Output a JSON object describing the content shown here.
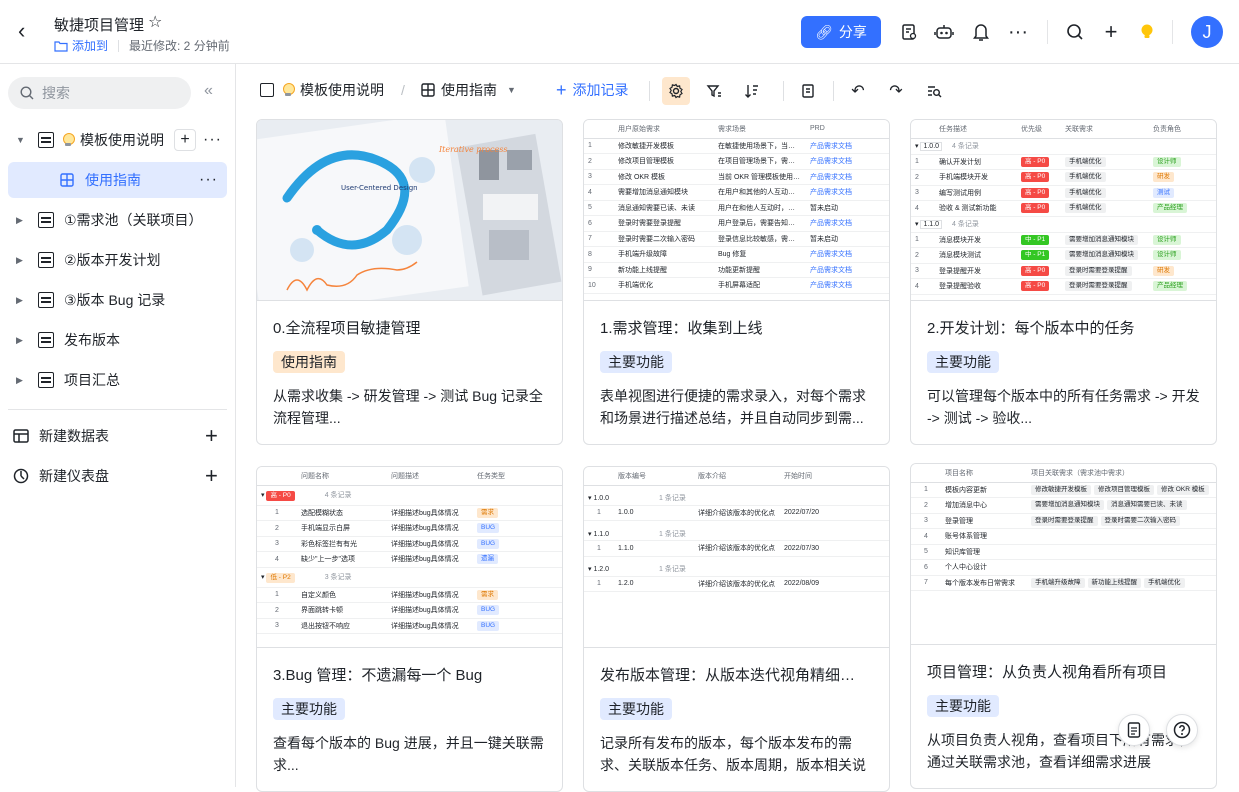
{
  "header": {
    "title": "敏捷项目管理",
    "add_to_label": "添加到",
    "last_modified": "最近修改: 2 分钟前",
    "share_label": "分享",
    "avatar_letter": "J"
  },
  "sidebar": {
    "search_placeholder": "搜索",
    "tree": [
      {
        "label": "模板使用说明"
      },
      {
        "label": "使用指南"
      },
      {
        "label": "①需求池（关联项目）"
      },
      {
        "label": "②版本开发计划"
      },
      {
        "label": "③版本 Bug 记录"
      },
      {
        "label": "发布版本"
      },
      {
        "label": "项目汇总"
      }
    ],
    "new_table_label": "新建数据表",
    "new_dashboard_label": "新建仪表盘"
  },
  "toolbar": {
    "breadcrumb_parent": "模板使用说明",
    "breadcrumb_current": "使用指南",
    "add_record_label": "添加记录"
  },
  "cards": [
    {
      "title": "0.全流程项目敏捷管理",
      "tag": "使用指南",
      "desc": "从需求收集 -> 研发管理 -> 测试 Bug 记录全流程管理..."
    },
    {
      "title": "1.需求管理：收集到上线",
      "tag": "主要功能",
      "desc": "表单视图进行便捷的需求录入，对每个需求和场景进行描述总结，并且自动同步到需..."
    },
    {
      "title": "2.开发计划：每个版本中的任务",
      "tag": "主要功能",
      "desc": "可以管理每个版本中的所有任务需求 -> 开发 -> 测试 -> 验收..."
    },
    {
      "title": "3.Bug 管理：不遗漏每一个 Bug",
      "tag": "主要功能",
      "desc": "查看每个版本的 Bug 进展，并且一键关联需求..."
    },
    {
      "title": "发布版本管理：从版本迭代视角精细…",
      "tag": "主要功能",
      "desc": "记录所有发布的版本，每个版本发布的需求、关联版本任务、版本周期，版本相关说明"
    },
    {
      "title": "项目管理：从负责人视角看所有项目",
      "tag": "主要功能",
      "desc": "从项目负责人视角，查看项目下所有需求，通过关联需求池，查看详细需求进展"
    }
  ],
  "thumb1": {
    "headers": [
      "用户原始需求",
      "需求场景",
      "PRD"
    ],
    "rows": [
      [
        "1",
        "修改敏捷开发模板",
        "在敏捷使用场景下，当…",
        "产品需求文档"
      ],
      [
        "2",
        "修改项目管理模板",
        "在项目管理场景下，需…",
        "产品需求文档"
      ],
      [
        "3",
        "修改 OKR 模板",
        "当前 OKR 管理模板使用…",
        "产品需求文档"
      ],
      [
        "4",
        "需要增加消息通知模块",
        "在用户和其他的人互动…",
        "产品需求文档"
      ],
      [
        "5",
        "消息通知需要已读、未读",
        "用户在和他人互动时，…",
        "暂未启动"
      ],
      [
        "6",
        "登录时需要登录提醒",
        "用户登录后，需要告知…",
        "产品需求文档"
      ],
      [
        "7",
        "登录时需要二次输入密码",
        "登录信息比较敏感，需…",
        "暂未启动"
      ],
      [
        "8",
        "手机端升级故障",
        "Bug 修复",
        "产品需求文档"
      ],
      [
        "9",
        "新功能上线提醒",
        "功能更新提醒",
        "产品需求文档"
      ],
      [
        "10",
        "手机端优化",
        "手机屏幕适配",
        "产品需求文档"
      ]
    ]
  },
  "thumb2": {
    "headers": [
      "任务描述",
      "优先级",
      "关联需求",
      "负责角色"
    ],
    "groups": [
      {
        "name": "1.0.0",
        "count": "4 条记录",
        "rows": [
          [
            "1",
            "确认开发计划",
            "高 - P0",
            "手机端优化",
            "设计师"
          ],
          [
            "2",
            "手机端模块开发",
            "高 - P0",
            "手机端优化",
            "研发"
          ],
          [
            "3",
            "编写测试用例",
            "高 - P0",
            "手机端优化",
            "测试"
          ],
          [
            "4",
            "验收 & 测试新功能",
            "高 - P0",
            "手机端优化",
            "产品经理"
          ]
        ]
      },
      {
        "name": "1.1.0",
        "count": "4 条记录",
        "rows": [
          [
            "1",
            "消息模块开发",
            "中 - P1",
            "需要增加消息通知模块",
            "设计师"
          ],
          [
            "2",
            "消息模块测试",
            "中 - P1",
            "需要增加消息通知模块",
            "设计师"
          ],
          [
            "3",
            "登录提醒开发",
            "高 - P0",
            "登录时需要登录提醒",
            "研发"
          ],
          [
            "4",
            "登录提醒验收",
            "高 - P0",
            "登录时需要登录提醒",
            "产品经理"
          ]
        ]
      }
    ]
  },
  "thumb3": {
    "headers": [
      "问题名称",
      "问题描述",
      "任务类型"
    ],
    "groups": [
      {
        "name": "高 - P0",
        "count": "4 条记录",
        "rows": [
          [
            "1",
            "选配模糊状态",
            "详细描述bug具体情况",
            "需求"
          ],
          [
            "2",
            "手机端显示白屏",
            "详细描述bug具体情况",
            "BUG"
          ],
          [
            "3",
            "彩色标签拦有有光",
            "详细描述bug具体情况",
            "BUG"
          ],
          [
            "4",
            "缺少\"上一步\"选项",
            "详细描述bug具体情况",
            "遗漏"
          ]
        ]
      },
      {
        "name": "低 - P2",
        "count": "3 条记录",
        "rows": [
          [
            "1",
            "自定义颜色",
            "详细描述bug具体情况",
            "需求"
          ],
          [
            "2",
            "界面跳转卡顿",
            "详细描述bug具体情况",
            "BUG"
          ],
          [
            "3",
            "退出按钮不响应",
            "详细描述bug具体情况",
            "BUG"
          ]
        ]
      }
    ]
  },
  "thumb4": {
    "headers": [
      "版本编号",
      "版本介绍",
      "开始时间"
    ],
    "groups": [
      {
        "name": "1.0.0",
        "count": "1 条记录",
        "row": [
          "1",
          "1.0.0",
          "详细介绍该版本的优化点",
          "2022/07/20"
        ]
      },
      {
        "name": "1.1.0",
        "count": "1 条记录",
        "row": [
          "1",
          "1.1.0",
          "详细介绍该版本的优化点",
          "2022/07/30"
        ]
      },
      {
        "name": "1.2.0",
        "count": "1 条记录",
        "row": [
          "1",
          "1.2.0",
          "详细介绍该版本的优化点",
          "2022/08/09"
        ]
      }
    ]
  },
  "thumb5": {
    "headers": [
      "项目名称",
      "项目关联需求（需求池中需求）"
    ],
    "rows": [
      [
        "1",
        "模板内容更新",
        [
          "修改敏捷开发模板",
          "修改项目管理模板",
          "修改 OKR 模板"
        ]
      ],
      [
        "2",
        "增加消息中心",
        [
          "需要增加消息通知模块",
          "消息通知需要已读、未读"
        ]
      ],
      [
        "3",
        "登录管理",
        [
          "登录时需要登录提醒",
          "登录时需要二次输入密码"
        ]
      ],
      [
        "4",
        "账号体系管理",
        []
      ],
      [
        "5",
        "知识库管理",
        []
      ],
      [
        "6",
        "个人中心设计",
        []
      ],
      [
        "7",
        "每个版本发布日常需求",
        [
          "手机端升级故障",
          "新功能上线提醒",
          "手机端优化"
        ]
      ]
    ]
  },
  "thumb0": {
    "diagram_text": "User-Centered Design",
    "handwriting": "Iterative process"
  }
}
